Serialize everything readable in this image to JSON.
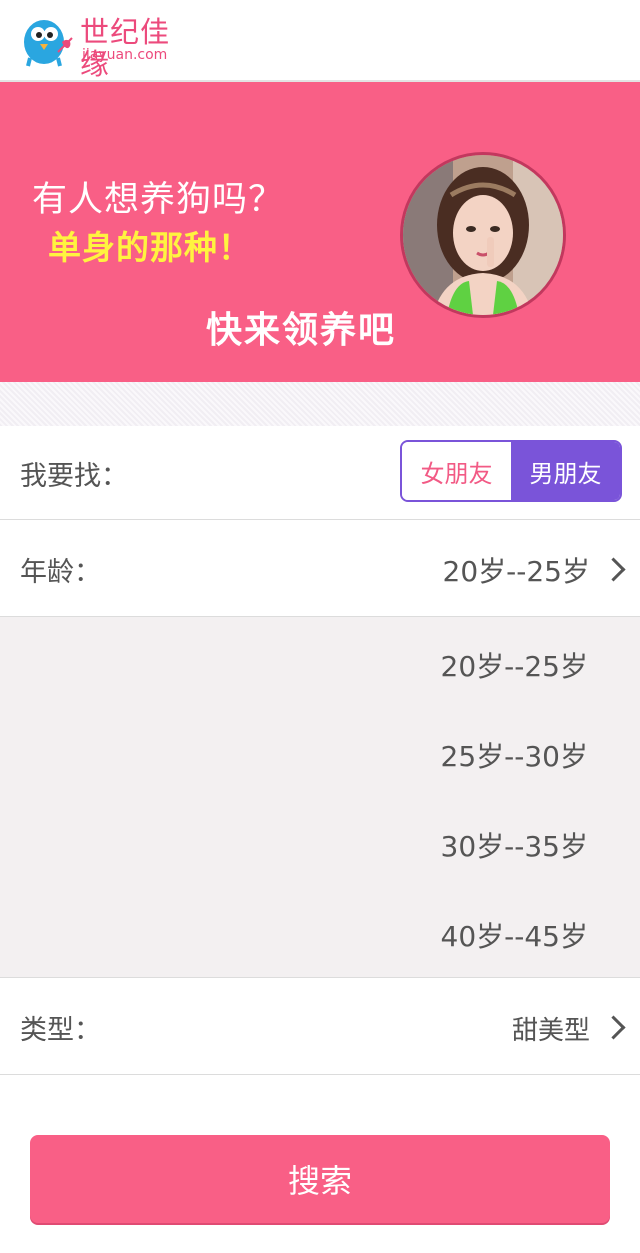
{
  "header": {
    "logo_text": "世纪佳缘",
    "logo_sub": "jiayuan.com"
  },
  "banner": {
    "line1": "有人想养狗吗？",
    "line2": "单身的那种！",
    "line3": "快来领养吧"
  },
  "form": {
    "seek_label": "我要找：",
    "seek_options": [
      "女朋友",
      "男朋友"
    ],
    "seek_selected": "男朋友",
    "age_label": "年龄：",
    "age_value": "20岁--25岁",
    "age_options": [
      "20岁--25岁",
      "25岁--30岁",
      "30岁--35岁",
      "40岁--45岁"
    ],
    "type_label": "类型：",
    "type_value": "甜美型"
  },
  "search_label": "搜索",
  "colors": {
    "accent": "#f95f86",
    "toggle": "#7a54d9",
    "highlight": "#fff33f"
  }
}
